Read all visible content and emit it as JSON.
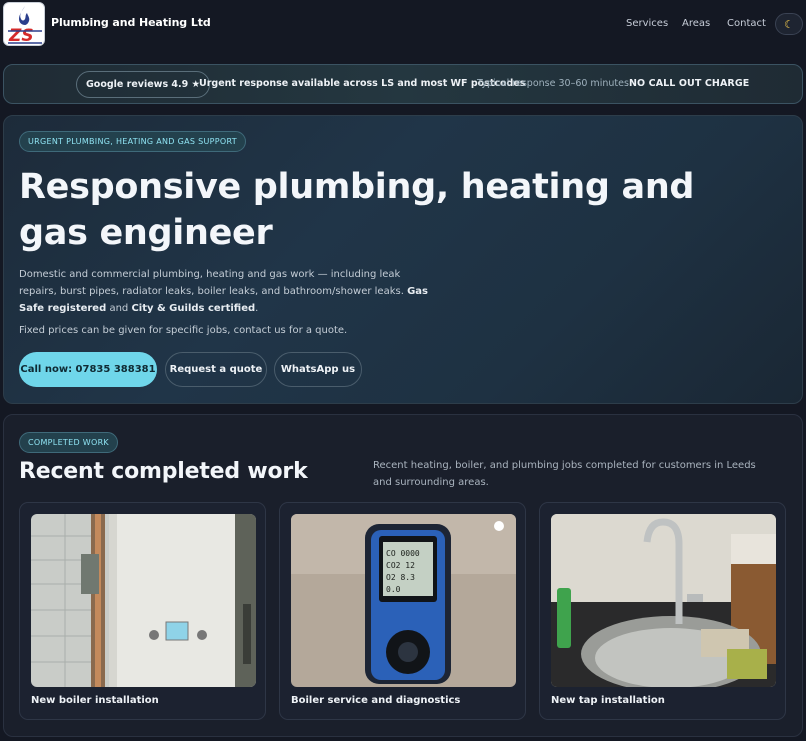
{
  "header": {
    "brand": "Plumbing and Heating Ltd",
    "logo_icon": "zs-flame-logo",
    "nav": [
      "Services",
      "Areas",
      "Contact"
    ],
    "theme_toggle_icon": "moon-icon"
  },
  "info_bar": {
    "reviews": "Google reviews 4.9 ★",
    "urgent": "Urgent response available across LS and most WF postcodes",
    "response": "Typical response 30–60 minutes",
    "no_call_out": "NO CALL OUT CHARGE"
  },
  "hero": {
    "badge": "URGENT PLUMBING, HEATING AND GAS SUPPORT",
    "title": "Responsive plumbing, heating and gas engineer",
    "desc_main": "Domestic and commercial plumbing, heating and gas work — including leak repairs, burst pipes, radiator leaks, boiler leaks, and bathroom/shower leaks. ",
    "desc_gas_safe": "Gas Safe registered",
    "desc_and": " and ",
    "desc_city_guilds": "City & Guilds certified",
    "desc_end": ".",
    "price_note": "Fixed prices can be given for specific jobs, contact us for a quote.",
    "buttons": {
      "call": "Call now: 07835 388381",
      "quote": "Request a quote",
      "whatsapp": "WhatsApp us"
    }
  },
  "work": {
    "badge": "COMPLETED WORK",
    "title": "Recent completed work",
    "desc": "Recent heating, boiler, and plumbing jobs completed for customers in Leeds and surrounding areas.",
    "cards": [
      {
        "label": "New boiler installation"
      },
      {
        "label": "Boiler service and diagnostics"
      },
      {
        "label": "New tap installation"
      }
    ]
  },
  "colors": {
    "background": "#141823",
    "accent": "#6fd6ea",
    "badge_text": "#8fe3f2"
  }
}
